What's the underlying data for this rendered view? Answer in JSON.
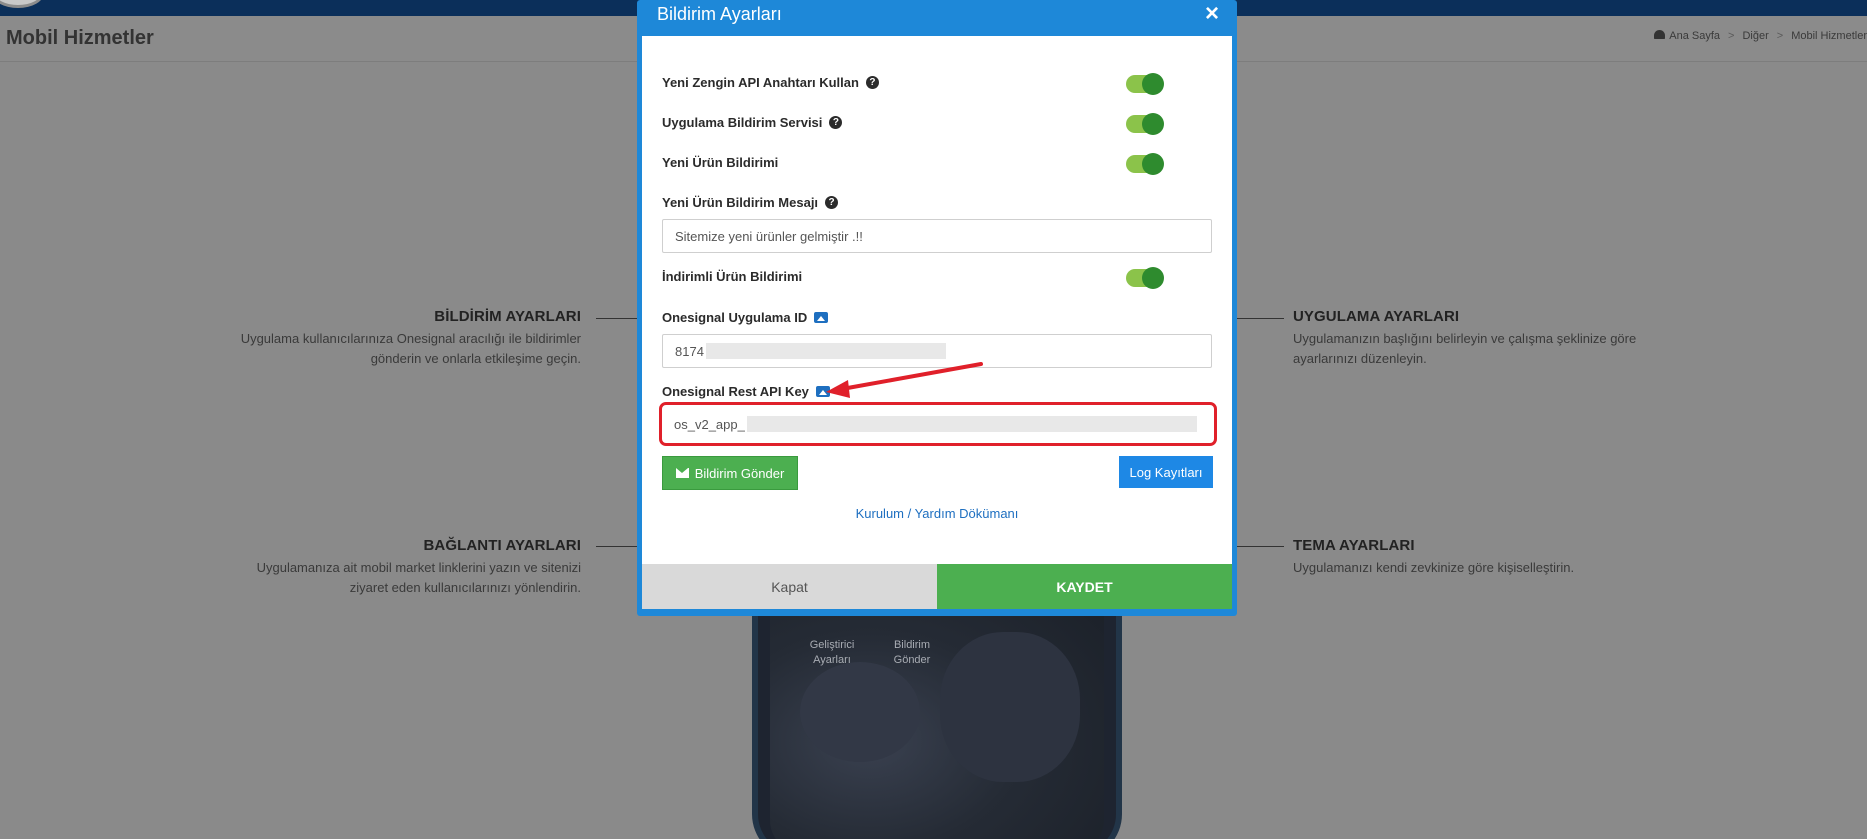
{
  "page": {
    "title": "Mobil Hizmetler",
    "breadcrumb": [
      "Ana Sayfa",
      "Diğer",
      "Mobil Hizmetler"
    ],
    "sections": {
      "bildirim": {
        "title": "BİLDİRİM AYARLARI",
        "desc_line1": "Uygulama kullanıcılarınıza Onesignal aracılığı ile bildirimler",
        "desc_line2": "gönderin ve onlarla etkileşime geçin."
      },
      "uygulama": {
        "title": "UYGULAMA AYARLARI",
        "desc_line1": "Uygulamanızın başlığını belirleyin ve çalışma şeklinize göre",
        "desc_line2": "ayarlarınızı düzenleyin."
      },
      "baglanti": {
        "title": "BAĞLANTI AYARLARI",
        "desc_line1": "Uygulamanıza ait mobil market linklerini yazın ve sitenizi",
        "desc_line2": "ziyaret eden kullanıcılarınızı yönlendirin."
      },
      "tema": {
        "title": "TEMA AYARLARI",
        "desc_line1": "Uygulamanızı kendi zevkinize göre kişiselleştirin."
      }
    },
    "phone_apps": [
      {
        "label_line1": "Geliştirici",
        "label_line2": "Ayarları"
      },
      {
        "label_line1": "Bildirim",
        "label_line2": "Gönder"
      }
    ]
  },
  "modal": {
    "title": "Bildirim Ayarları",
    "close_symbol": "×",
    "fields": {
      "rich_api": {
        "label": "Yeni Zengin API Anahtarı Kullan",
        "enabled": true
      },
      "app_service": {
        "label": "Uygulama Bildirim Servisi",
        "enabled": true
      },
      "new_product": {
        "label": "Yeni Ürün Bildirimi",
        "enabled": true
      },
      "new_product_msg": {
        "label": "Yeni Ürün Bildirim Mesajı",
        "value": "Sitemize yeni ürünler gelmiştir .!!"
      },
      "discount": {
        "label": "İndirimli Ürün Bildirimi",
        "enabled": true
      },
      "app_id": {
        "label": "Onesignal Uygulama ID",
        "value": "8174"
      },
      "rest_key": {
        "label": "Onesignal Rest API Key",
        "value": "os_v2_app_"
      }
    },
    "buttons": {
      "send": "Bildirim Gönder",
      "logs": "Log Kayıtları",
      "help": "Kurulum / Yardım Dökümanı",
      "close": "Kapat",
      "save": "KAYDET"
    }
  },
  "colors": {
    "modal_header": "#1e88d8",
    "toggle_on": "#2e8b2e",
    "highlight": "#e0202a",
    "save": "#4caf50",
    "logs": "#1e88e5"
  }
}
